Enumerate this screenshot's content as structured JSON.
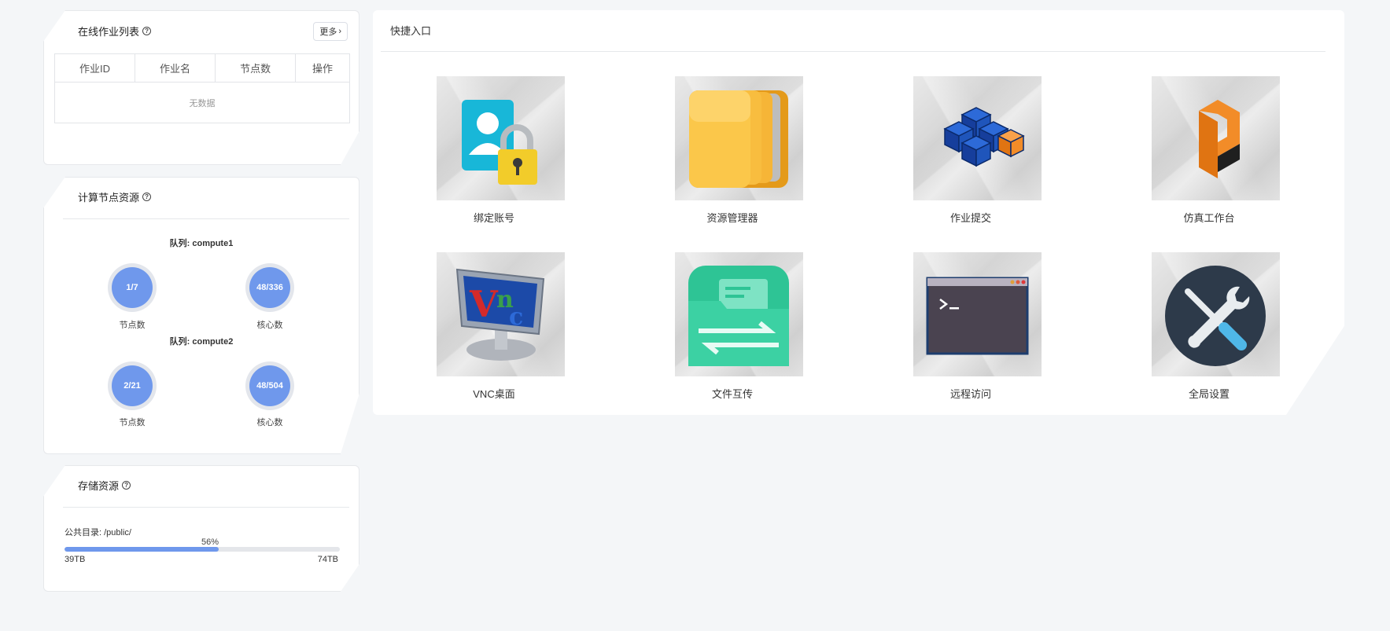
{
  "jobs_panel": {
    "title": "在线作业列表",
    "more_label": "更多",
    "columns": [
      "作业ID",
      "作业名",
      "节点数",
      "操作"
    ],
    "empty_text": "无数据"
  },
  "compute_panel": {
    "title": "计算节点资源",
    "queues": [
      {
        "label": "队列: compute1",
        "nodes": {
          "value": "1/7",
          "caption": "节点数"
        },
        "cores": {
          "value": "48/336",
          "caption": "核心数"
        }
      },
      {
        "label": "队列: compute2",
        "nodes": {
          "value": "2/21",
          "caption": "节点数"
        },
        "cores": {
          "value": "48/504",
          "caption": "核心数"
        }
      }
    ]
  },
  "storage_panel": {
    "title": "存储资源",
    "path_label": "公共目录: /public/",
    "percent_label": "56%",
    "used_fraction": 0.56,
    "used": "39TB",
    "total": "74TB",
    "bar_color": "#6f98ec"
  },
  "quick_access": {
    "title": "快捷入口",
    "tiles": [
      {
        "label": "绑定账号",
        "icon": "bind-account-icon"
      },
      {
        "label": "资源管理器",
        "icon": "file-manager-icon"
      },
      {
        "label": "作业提交",
        "icon": "job-submit-icon"
      },
      {
        "label": "仿真工作台",
        "icon": "simulation-workbench-icon"
      },
      {
        "label": "VNC桌面",
        "icon": "vnc-desktop-icon"
      },
      {
        "label": "文件互传",
        "icon": "file-transfer-icon"
      },
      {
        "label": "远程访问",
        "icon": "terminal-icon"
      },
      {
        "label": "全局设置",
        "icon": "settings-tools-icon"
      }
    ]
  },
  "colors": {
    "page_bg": "#f4f6f8",
    "gauge": "#6f98ec",
    "accent_orange": "#f28c28",
    "teal": "#3cc49e",
    "dark_slate": "#2d3a4a"
  }
}
